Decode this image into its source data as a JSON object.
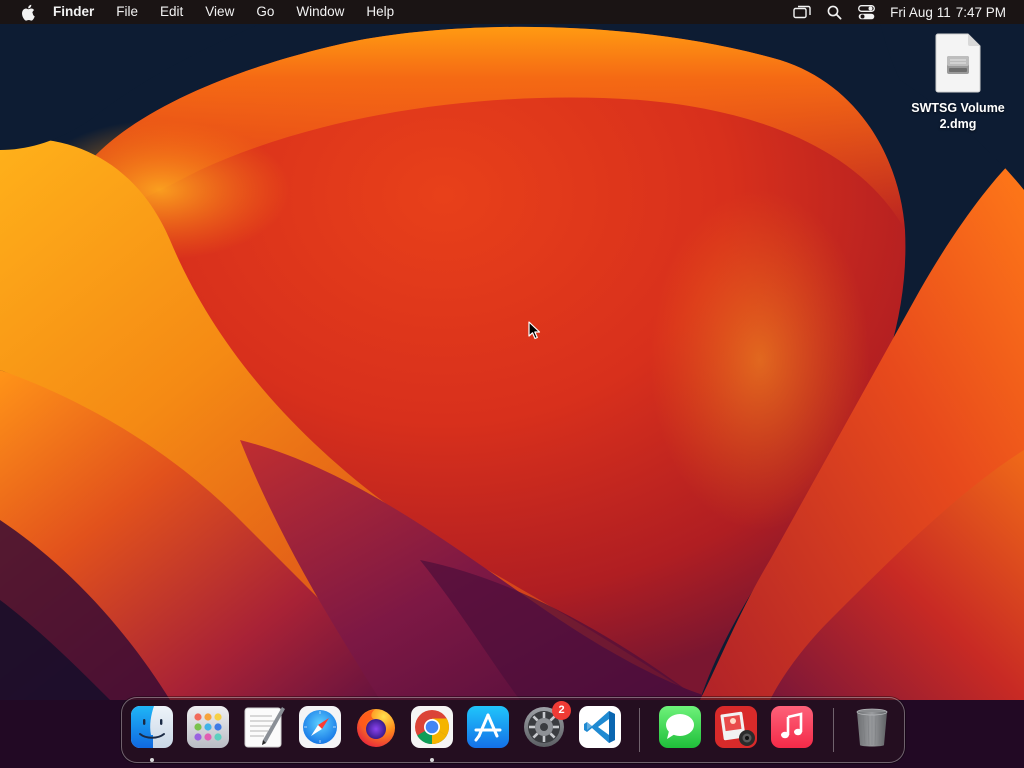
{
  "menubar": {
    "app_name": "Finder",
    "menus": [
      "File",
      "Edit",
      "View",
      "Go",
      "Window",
      "Help"
    ],
    "clock": {
      "date": "Fri Aug 11",
      "time": "7:47 PM"
    },
    "status_icons": [
      "screen-mirroring-icon",
      "spotlight-search-icon",
      "control-center-icon"
    ]
  },
  "desktop": {
    "icons": [
      {
        "label": "SWTSG Volume 2.dmg",
        "icon": "disk-image-icon"
      }
    ]
  },
  "dock": {
    "apps": [
      {
        "name": "Finder",
        "icon": "finder-icon",
        "running": true
      },
      {
        "name": "Launchpad",
        "icon": "launchpad-icon",
        "running": false
      },
      {
        "name": "TextEdit",
        "icon": "textedit-icon",
        "running": false
      },
      {
        "name": "Safari",
        "icon": "safari-icon",
        "running": false
      },
      {
        "name": "Firefox",
        "icon": "firefox-icon",
        "running": false
      },
      {
        "name": "Google Chrome",
        "icon": "chrome-icon",
        "running": true
      },
      {
        "name": "App Store",
        "icon": "app-store-icon",
        "running": false
      },
      {
        "name": "System Settings",
        "icon": "system-settings-icon",
        "running": false,
        "badge": "2"
      },
      {
        "name": "Visual Studio Code",
        "icon": "vscode-icon",
        "running": false
      },
      {
        "name": "Messages",
        "icon": "messages-icon",
        "running": false
      },
      {
        "name": "Photo Booth",
        "icon": "photo-booth-icon",
        "running": false
      },
      {
        "name": "Music",
        "icon": "music-icon",
        "running": false
      },
      {
        "name": "Trash",
        "icon": "trash-icon",
        "running": false
      }
    ]
  },
  "colors": {
    "menubar_bg": "#1a1414",
    "wallpaper_orange": "#f07a10",
    "wallpaper_red": "#c8261a",
    "wallpaper_purple": "#6a1748",
    "wallpaper_navy": "#0d1c33",
    "badge_red": "#ef3b35"
  }
}
